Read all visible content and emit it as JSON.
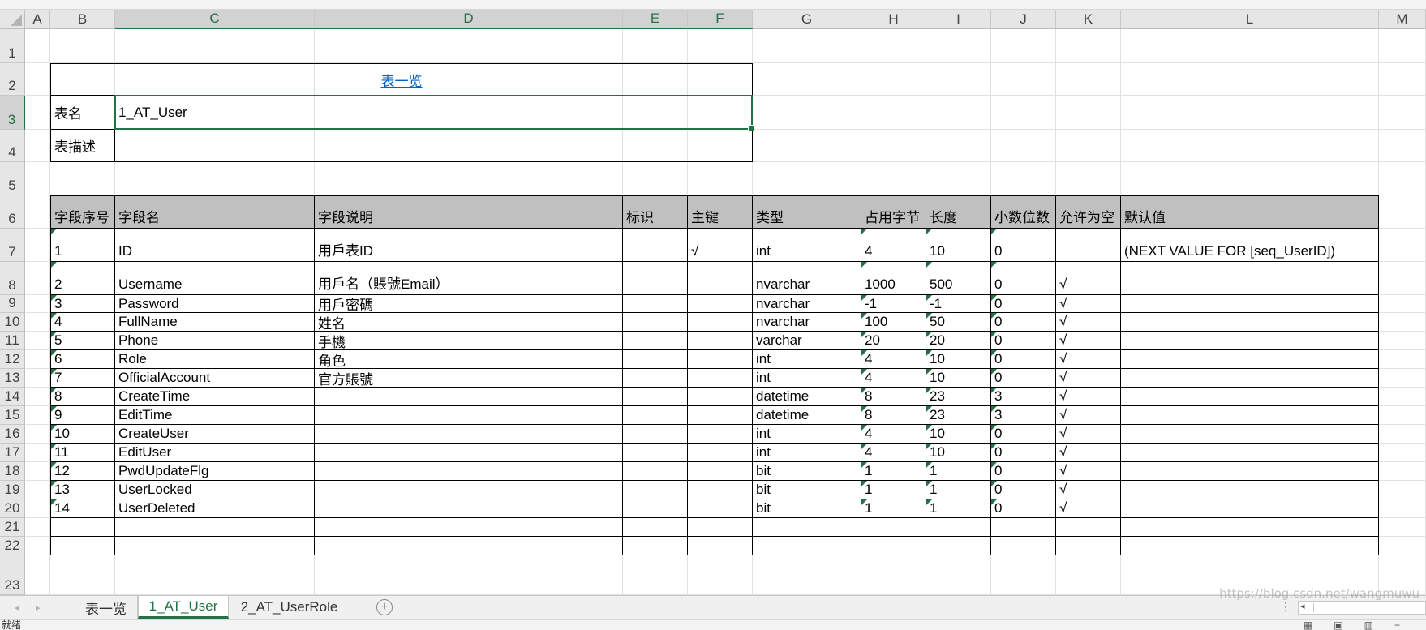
{
  "spreadsheet": {
    "columns": [
      "A",
      "B",
      "C",
      "D",
      "E",
      "F",
      "G",
      "H",
      "I",
      "J",
      "K",
      "L",
      "M"
    ],
    "selected_columns": [
      "C",
      "D",
      "E",
      "F"
    ],
    "rows": [
      "1",
      "2",
      "3",
      "4",
      "5",
      "6",
      "7",
      "8",
      "9",
      "10",
      "11",
      "12",
      "13",
      "14",
      "15",
      "16",
      "17",
      "18",
      "19",
      "20",
      "21",
      "22",
      "23"
    ],
    "selected_row": "3",
    "title_link": "表一览",
    "table_name_label": "表名",
    "table_name_value": "1_AT_User",
    "table_desc_label": "表描述",
    "table_desc_value": "",
    "field_headers": [
      "字段序号",
      "字段名",
      "字段说明",
      "标识",
      "主键",
      "类型",
      "占用字节",
      "长度",
      "小数位数",
      "允许为空",
      "默认值"
    ],
    "fields": [
      [
        "1",
        "ID",
        "用戶表ID",
        "",
        "√",
        "int",
        "4",
        "10",
        "0",
        "",
        "(NEXT VALUE FOR [seq_UserID])"
      ],
      [
        "2",
        "Username",
        "用戶名（賬號Email）",
        "",
        "",
        "nvarchar",
        "1000",
        "500",
        "0",
        "√",
        ""
      ],
      [
        "3",
        "Password",
        "用戶密碼",
        "",
        "",
        "nvarchar",
        "-1",
        "-1",
        "0",
        "√",
        ""
      ],
      [
        "4",
        "FullName",
        "姓名",
        "",
        "",
        "nvarchar",
        "100",
        "50",
        "0",
        "√",
        ""
      ],
      [
        "5",
        "Phone",
        "手機",
        "",
        "",
        "varchar",
        "20",
        "20",
        "0",
        "√",
        ""
      ],
      [
        "6",
        "Role",
        "角色",
        "",
        "",
        "int",
        "4",
        "10",
        "0",
        "√",
        ""
      ],
      [
        "7",
        "OfficialAccount",
        "官方賬號",
        "",
        "",
        "int",
        "4",
        "10",
        "0",
        "√",
        ""
      ],
      [
        "8",
        "CreateTime",
        "",
        "",
        "",
        "datetime",
        "8",
        "23",
        "3",
        "√",
        ""
      ],
      [
        "9",
        "EditTime",
        "",
        "",
        "",
        "datetime",
        "8",
        "23",
        "3",
        "√",
        ""
      ],
      [
        "10",
        "CreateUser",
        "",
        "",
        "",
        "int",
        "4",
        "10",
        "0",
        "√",
        ""
      ],
      [
        "11",
        "EditUser",
        "",
        "",
        "",
        "int",
        "4",
        "10",
        "0",
        "√",
        ""
      ],
      [
        "12",
        "PwdUpdateFlg",
        "",
        "",
        "",
        "bit",
        "1",
        "1",
        "0",
        "√",
        ""
      ],
      [
        "13",
        "UserLocked",
        "",
        "",
        "",
        "bit",
        "1",
        "1",
        "0",
        "√",
        ""
      ],
      [
        "14",
        "UserDeleted",
        "",
        "",
        "",
        "bit",
        "1",
        "1",
        "0",
        "√",
        ""
      ]
    ]
  },
  "tabs": {
    "items": [
      "表一览",
      "1_AT_User",
      "2_AT_UserRole"
    ],
    "active": "1_AT_User",
    "add_label": "+",
    "nav_prev": "◂",
    "nav_next": "▸"
  },
  "status": {
    "text": "就绪",
    "view_icons": [
      "normal-view-icon",
      "page-layout-icon",
      "page-break-icon"
    ],
    "zoom_minus": "−"
  },
  "watermark": "https://blog.csdn.net/wangmuwu"
}
